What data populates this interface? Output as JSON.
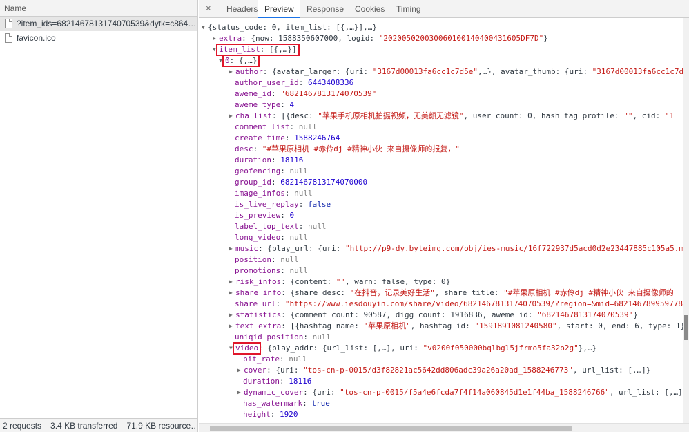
{
  "network_panel": {
    "name_header": "Name",
    "requests": [
      {
        "name": "?item_ids=6821467813174070539&dytk=c864…",
        "selected": true
      },
      {
        "name": "favicon.ico",
        "selected": false
      }
    ],
    "status": {
      "requests": "2 requests",
      "transferred": "3.4 KB transferred",
      "resources": "71.9 KB resource…"
    }
  },
  "tabs": {
    "close": "×",
    "items": [
      "Headers",
      "Preview",
      "Response",
      "Cookies",
      "Timing"
    ],
    "active": "Preview"
  },
  "preview": {
    "highlight_color": "#e0162b",
    "lines": [
      [
        {
          "t": "▼",
          "c": "tri"
        },
        {
          "t": "{status_code: 0, item_list: [{,…}],…}",
          "c": "p"
        }
      ],
      [
        {
          "t": "▶",
          "c": "tri"
        },
        {
          "t": "extra",
          "c": "key"
        },
        {
          "t": ": {now: 1588350607000, logid: ",
          "c": "p"
        },
        {
          "t": "\"202005020030060100140400431605DF7D\"",
          "c": "str"
        },
        {
          "t": "}",
          "c": "p"
        }
      ],
      [
        {
          "t": "▼",
          "c": "tri"
        },
        {
          "t": "item_list",
          "c": "key"
        },
        {
          "t": ": [{,…}]",
          "c": "p"
        }
      ],
      [
        {
          "t": "▼",
          "c": "tri"
        },
        {
          "t": "0",
          "c": "key"
        },
        {
          "t": ": {,…}",
          "c": "p"
        }
      ],
      [
        {
          "t": "▶",
          "c": "tri"
        },
        {
          "t": "author",
          "c": "key"
        },
        {
          "t": ": {avatar_larger: {uri: ",
          "c": "p"
        },
        {
          "t": "\"3167d00013fa6cc1c7d5e\"",
          "c": "str"
        },
        {
          "t": ",…}, avatar_thumb: {uri: ",
          "c": "p"
        },
        {
          "t": "\"3167d00013fa6cc1c7d5",
          "c": "str"
        }
      ],
      [
        {
          "t": "author_user_id",
          "c": "key"
        },
        {
          "t": ": ",
          "c": "p"
        },
        {
          "t": "6443408336",
          "c": "num"
        }
      ],
      [
        {
          "t": "aweme_id",
          "c": "key"
        },
        {
          "t": ": ",
          "c": "p"
        },
        {
          "t": "\"6821467813174070539\"",
          "c": "str"
        }
      ],
      [
        {
          "t": "aweme_type",
          "c": "key"
        },
        {
          "t": ": ",
          "c": "p"
        },
        {
          "t": "4",
          "c": "num"
        }
      ],
      [
        {
          "t": "▶",
          "c": "tri"
        },
        {
          "t": "cha_list",
          "c": "key"
        },
        {
          "t": ": [{desc: ",
          "c": "p"
        },
        {
          "t": "\"苹果手机原相机拍摄视频，无美颜无滤镜\"",
          "c": "str"
        },
        {
          "t": ", user_count: 0, hash_tag_profile: ",
          "c": "p"
        },
        {
          "t": "\"\"",
          "c": "str"
        },
        {
          "t": ", cid: ",
          "c": "p"
        },
        {
          "t": "\"1",
          "c": "str"
        }
      ],
      [
        {
          "t": "comment_list",
          "c": "key"
        },
        {
          "t": ": ",
          "c": "p"
        },
        {
          "t": "null",
          "c": "nul"
        }
      ],
      [
        {
          "t": "create_time",
          "c": "key"
        },
        {
          "t": ": ",
          "c": "p"
        },
        {
          "t": "1588246764",
          "c": "num"
        }
      ],
      [
        {
          "t": "desc",
          "c": "key"
        },
        {
          "t": ": ",
          "c": "p"
        },
        {
          "t": "\"#苹果原相机 #赤伶dj #精神小伙 来自摄像师的报复，\"",
          "c": "str"
        }
      ],
      [
        {
          "t": "duration",
          "c": "key"
        },
        {
          "t": ": ",
          "c": "p"
        },
        {
          "t": "18116",
          "c": "num"
        }
      ],
      [
        {
          "t": "geofencing",
          "c": "key"
        },
        {
          "t": ": ",
          "c": "p"
        },
        {
          "t": "null",
          "c": "nul"
        }
      ],
      [
        {
          "t": "group_id",
          "c": "key"
        },
        {
          "t": ": ",
          "c": "p"
        },
        {
          "t": "6821467813174070000",
          "c": "num"
        }
      ],
      [
        {
          "t": "image_infos",
          "c": "key"
        },
        {
          "t": ": ",
          "c": "p"
        },
        {
          "t": "null",
          "c": "nul"
        }
      ],
      [
        {
          "t": "is_live_replay",
          "c": "key"
        },
        {
          "t": ": ",
          "c": "p"
        },
        {
          "t": "false",
          "c": "bool"
        }
      ],
      [
        {
          "t": "is_preview",
          "c": "key"
        },
        {
          "t": ": ",
          "c": "p"
        },
        {
          "t": "0",
          "c": "num"
        }
      ],
      [
        {
          "t": "label_top_text",
          "c": "key"
        },
        {
          "t": ": ",
          "c": "p"
        },
        {
          "t": "null",
          "c": "nul"
        }
      ],
      [
        {
          "t": "long_video",
          "c": "key"
        },
        {
          "t": ": ",
          "c": "p"
        },
        {
          "t": "null",
          "c": "nul"
        }
      ],
      [
        {
          "t": "▶",
          "c": "tri"
        },
        {
          "t": "music",
          "c": "key"
        },
        {
          "t": ": {play_url: {uri: ",
          "c": "p"
        },
        {
          "t": "\"http://p9-dy.byteimg.com/obj/ies-music/16f722937d5acd0d2e23447885c105a5.mp",
          "c": "str"
        }
      ],
      [
        {
          "t": "position",
          "c": "key"
        },
        {
          "t": ": ",
          "c": "p"
        },
        {
          "t": "null",
          "c": "nul"
        }
      ],
      [
        {
          "t": "promotions",
          "c": "key"
        },
        {
          "t": ": ",
          "c": "p"
        },
        {
          "t": "null",
          "c": "nul"
        }
      ],
      [
        {
          "t": "▶",
          "c": "tri"
        },
        {
          "t": "risk_infos",
          "c": "key"
        },
        {
          "t": ": {content: ",
          "c": "p"
        },
        {
          "t": "\"\"",
          "c": "str"
        },
        {
          "t": ", warn: false, type: 0}",
          "c": "p"
        }
      ],
      [
        {
          "t": "▶",
          "c": "tri"
        },
        {
          "t": "share_info",
          "c": "key"
        },
        {
          "t": ": {share_desc: ",
          "c": "p"
        },
        {
          "t": "\"在抖音，记录美好生活\"",
          "c": "str"
        },
        {
          "t": ", share_title: ",
          "c": "p"
        },
        {
          "t": "\"#苹果原相机 #赤伶dj #精神小伙 来自摄像师的",
          "c": "str"
        }
      ],
      [
        {
          "t": "share_url",
          "c": "key"
        },
        {
          "t": ": ",
          "c": "p"
        },
        {
          "t": "\"https://www.iesdouyin.com/share/video/6821467813174070539/?region=&mid=6821467899597785",
          "c": "str"
        }
      ],
      [
        {
          "t": "▶",
          "c": "tri"
        },
        {
          "t": "statistics",
          "c": "key"
        },
        {
          "t": ": {comment_count: 90587, digg_count: 1916836, aweme_id: ",
          "c": "p"
        },
        {
          "t": "\"6821467813174070539\"",
          "c": "str"
        },
        {
          "t": "}",
          "c": "p"
        }
      ],
      [
        {
          "t": "▶",
          "c": "tri"
        },
        {
          "t": "text_extra",
          "c": "key"
        },
        {
          "t": ": [{hashtag_name: ",
          "c": "p"
        },
        {
          "t": "\"苹果原相机\"",
          "c": "str"
        },
        {
          "t": ", hashtag_id: ",
          "c": "p"
        },
        {
          "t": "\"1591891081240580\"",
          "c": "str"
        },
        {
          "t": ", start: 0, end: 6, type: 1},…",
          "c": "p"
        }
      ],
      [
        {
          "t": "uniqid_position",
          "c": "key"
        },
        {
          "t": ": ",
          "c": "p"
        },
        {
          "t": "null",
          "c": "nul"
        }
      ],
      [
        {
          "t": "▼",
          "c": "tri"
        },
        {
          "t": "video",
          "c": "key"
        },
        {
          "t": ": {play_addr: {url_list: [,…], uri: ",
          "c": "p"
        },
        {
          "t": "\"v0200f050000bqlbgl5jfrmo5fa32o2g\"",
          "c": "str"
        },
        {
          "t": "},…}",
          "c": "p"
        }
      ],
      [
        {
          "t": "bit_rate",
          "c": "key"
        },
        {
          "t": ": ",
          "c": "p"
        },
        {
          "t": "null",
          "c": "nul"
        }
      ],
      [
        {
          "t": "▶",
          "c": "tri"
        },
        {
          "t": "cover",
          "c": "key"
        },
        {
          "t": ": {uri: ",
          "c": "p"
        },
        {
          "t": "\"tos-cn-p-0015/d3f82821ac5642dd806adc39a26a20ad_1588246773\"",
          "c": "str"
        },
        {
          "t": ", url_list: [,…]}",
          "c": "p"
        }
      ],
      [
        {
          "t": "duration",
          "c": "key"
        },
        {
          "t": ": ",
          "c": "p"
        },
        {
          "t": "18116",
          "c": "num"
        }
      ],
      [
        {
          "t": "▶",
          "c": "tri"
        },
        {
          "t": "dynamic_cover",
          "c": "key"
        },
        {
          "t": ": {uri: ",
          "c": "p"
        },
        {
          "t": "\"tos-cn-p-0015/f5a4e6fcda7f4f14a060845d1e1f44ba_1588246766\"",
          "c": "str"
        },
        {
          "t": ", url_list: [,…]}",
          "c": "p"
        }
      ],
      [
        {
          "t": "has_watermark",
          "c": "key"
        },
        {
          "t": ": ",
          "c": "p"
        },
        {
          "t": "true",
          "c": "bool"
        }
      ],
      [
        {
          "t": "height",
          "c": "key"
        },
        {
          "t": ": ",
          "c": "p"
        },
        {
          "t": "1920",
          "c": "num"
        }
      ]
    ]
  }
}
